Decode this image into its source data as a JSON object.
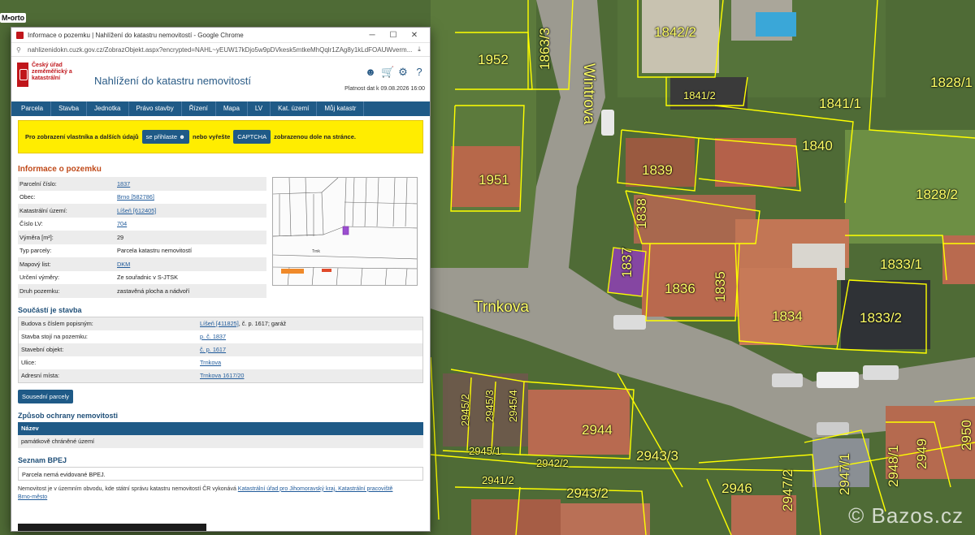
{
  "map": {
    "badge": "M•orto",
    "watermark": "© Bazos.cz",
    "streets": [
      {
        "name": "Wintrova",
        "orientation": "vertical"
      },
      {
        "name": "Trnkova",
        "orientation": "horizontal"
      }
    ],
    "parcels": [
      "1952",
      "1863/3",
      "1842/2",
      "1841/2",
      "1841/1",
      "1828/1",
      "1951",
      "1839",
      "1840",
      "1828/2",
      "1838",
      "1837",
      "1836",
      "1835",
      "1834",
      "1833/1",
      "1833/2",
      "2945/2",
      "2945/3",
      "2945/4",
      "2944",
      "2943/3",
      "2945/1",
      "2942/2",
      "2941/2",
      "2943/2",
      "2946",
      "2947/2",
      "2947/1",
      "2948/1",
      "2949",
      "2950"
    ]
  },
  "browser": {
    "window_title": "Informace o pozemku | Nahlížení do katastru nemovitostí - Google Chrome",
    "url": "nahlizenidokn.cuzk.gov.cz/ZobrazObjekt.aspx?encrypted=NAHL~yEUW17kDjo5w9pDVkesk5mtkeMhQqlr1ZAg8y1kLdFOAUWverm..."
  },
  "site": {
    "logo_text": "Český úřad zeměměřický a katastrální",
    "title": "Nahlížení do katastru nemovitostí",
    "validity": "Platnost dat k 09.08.2026 16:00",
    "nav": [
      "Parcela",
      "Stavba",
      "Jednotka",
      "Právo stavby",
      "Řízení",
      "Mapa",
      "LV",
      "Kat. území",
      "Můj katastr"
    ]
  },
  "notice": {
    "pre": "Pro zobrazení vlastníka a dalších údajů",
    "login_btn": "se přihlaste",
    "mid": "nebo vyřešte",
    "captcha_btn": "CAPTCHA",
    "post": "zobrazenou dole na stránce."
  },
  "parcel_info": {
    "heading": "Informace o pozemku",
    "rows": [
      {
        "label": "Parcelní číslo:",
        "value": "1837"
      },
      {
        "label": "Obec:",
        "value": "Brno [582786]"
      },
      {
        "label": "Katastrální území:",
        "value": "Líšeň [612405]"
      },
      {
        "label": "Číslo LV:",
        "value": "704"
      },
      {
        "label": "Výměra [m²]:",
        "value": "29"
      },
      {
        "label": "Typ parcely:",
        "value": "Parcela katastru nemovitostí"
      },
      {
        "label": "Mapový list:",
        "value": "DKM"
      },
      {
        "label": "Určení výměry:",
        "value": "Ze souřadnic v S-JTSK"
      },
      {
        "label": "Druh pozemku:",
        "value": "zastavěná plocha a nádvoří"
      }
    ]
  },
  "building": {
    "heading": "Součástí je stavba",
    "rows": [
      {
        "label": "Budova s číslem popisným:",
        "value": "Líšeň [411825]",
        "suffix": ", č. p. 1617; garáž"
      },
      {
        "label": "Stavba stojí na pozemku:",
        "value": "p. č. 1837"
      },
      {
        "label": "Stavební objekt:",
        "value": "č. p. 1617"
      },
      {
        "label": "Ulice:",
        "value": "Trnkova"
      },
      {
        "label": "Adresní místa:",
        "value": "Trnkova 1617/20"
      }
    ],
    "neighbors_btn": "Sousední parcely"
  },
  "protection": {
    "heading": "Způsob ochrany nemovitosti",
    "col": "Název",
    "value": "památkově chráněné území"
  },
  "bpej": {
    "heading": "Seznam BPEJ",
    "value": "Parcela nemá evidované BPEJ."
  },
  "footer": {
    "text": "Nemovitost je v územním obvodu, kde státní správu katastru nemovitostí ČR vykonává",
    "link": "Katastrální úřad pro Jihomoravský kraj, Katastrální pracoviště Brno-město"
  }
}
